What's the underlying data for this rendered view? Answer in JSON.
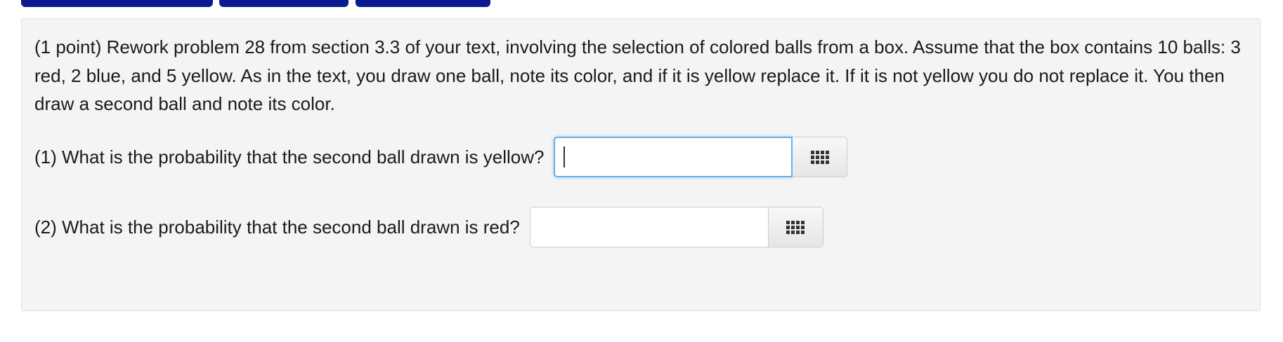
{
  "problem": {
    "text": "(1 point) Rework problem 28 from section 3.3 of your text, involving the selection of colored balls from a box. Assume that the box contains 10 balls: 3 red, 2 blue, and 5 yellow. As in the text, you draw one ball, note its color, and if it is yellow replace it. If it is not yellow you do not replace it. You then draw a second ball and note its color."
  },
  "questions": [
    {
      "label": "(1) What is the probability that the second ball drawn is yellow?",
      "value": "",
      "focused": true,
      "palette_icon": "grid-icon"
    },
    {
      "label": "(2) What is the probability that the second ball drawn is red?",
      "value": "",
      "focused": false,
      "palette_icon": "grid-icon"
    }
  ],
  "colors": {
    "nav_tab": "#0a1a8f",
    "panel_background": "#f4f4f4",
    "focus_border": "#66afe9"
  }
}
